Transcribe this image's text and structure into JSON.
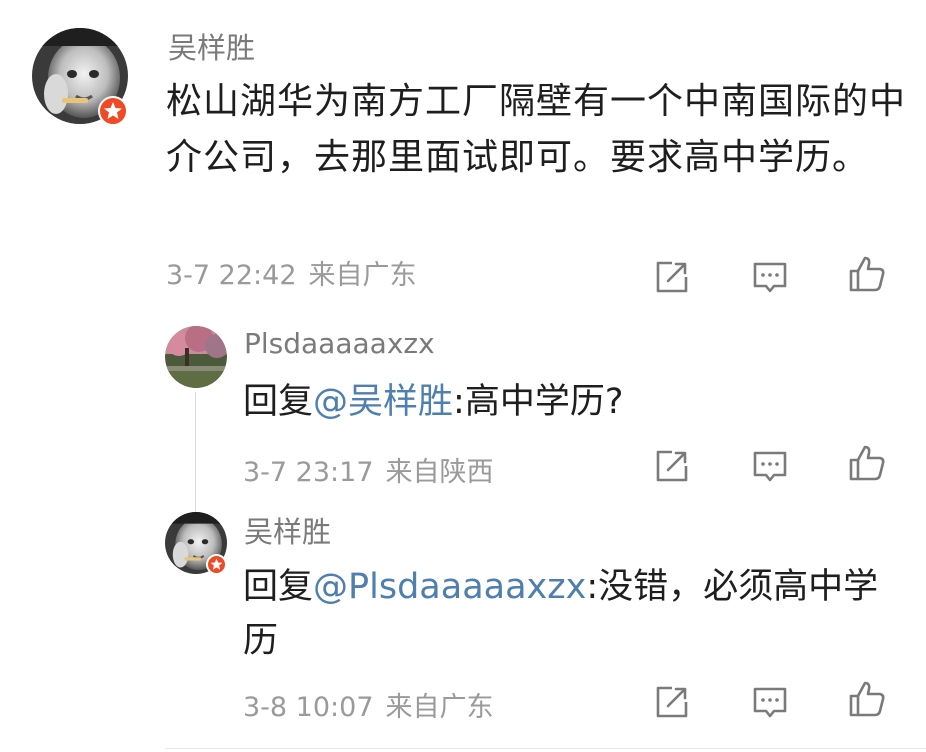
{
  "comment": {
    "author": "吴样胜",
    "text": "松山湖华为南方工厂隔壁有一个中南国际的中介公司，去那里面试即可。要求高中学历。",
    "time": "3-7 22:42",
    "location": "来自广东",
    "actions": [
      "share-icon",
      "comment-icon",
      "like-icon"
    ]
  },
  "replies": [
    {
      "author": "Plsdaaaaaxzx",
      "prefix": "回复",
      "mention": "@吴样胜",
      "body": ":高中学历?",
      "time": "3-7 23:17",
      "location": "来自陕西"
    },
    {
      "author": "吴样胜",
      "prefix": "回复",
      "mention": "@Plsdaaaaaxzx",
      "body": ":没错，必须高中学历",
      "time": "3-8 10:07",
      "location": "来自广东"
    }
  ],
  "colors": {
    "mention": "#4f7fae",
    "badge": "#f04a24",
    "name": "#7a7a7a",
    "meta": "#9a9a9a"
  }
}
